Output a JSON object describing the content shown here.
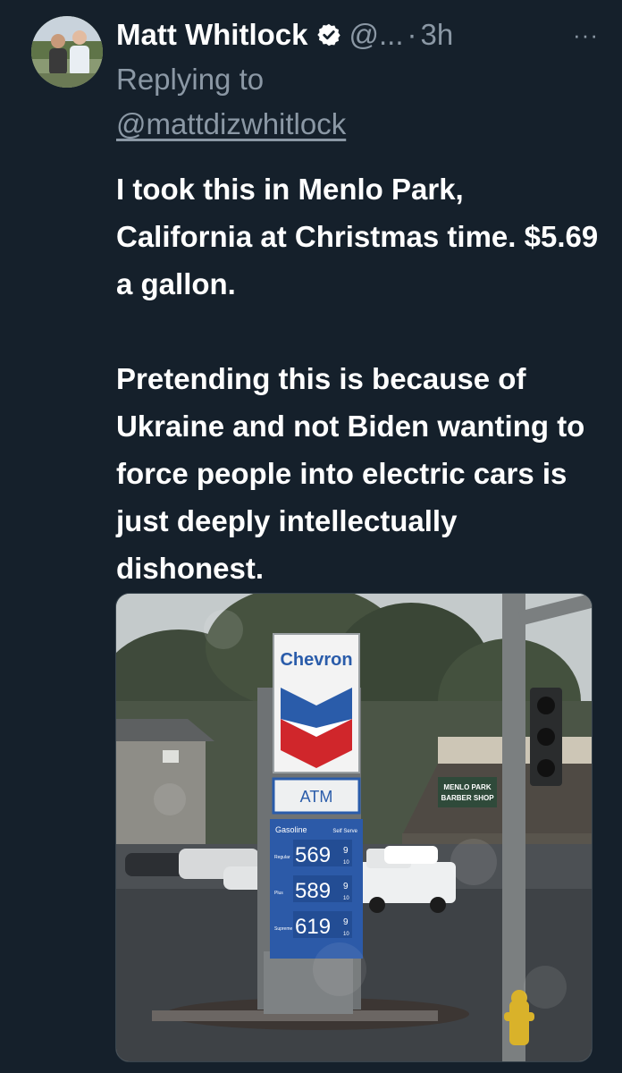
{
  "tweet": {
    "author_name": "Matt Whitlock",
    "handle": "@...",
    "separator": "·",
    "time": "3h",
    "more_label": "···",
    "replying_label": "Replying to",
    "reply_mention": "@mattdizwhitlock",
    "paragraphs": [
      "I took this in Menlo Park, California at Christmas time. $5.69 a gallon.",
      "Pretending this is because of Ukraine and not Biden wanting to force people into electric cars is just deeply intellectually dishonest."
    ]
  },
  "photo": {
    "brand": "Chevron",
    "atm": "ATM",
    "gasoline_label": "Gasoline",
    "self_serve_label": "Self Serve",
    "grades": [
      {
        "name": "Regular",
        "price": "569",
        "fraction": "9",
        "tenths": "10"
      },
      {
        "name": "Plus",
        "price": "589",
        "fraction": "9",
        "tenths": "10"
      },
      {
        "name": "Supreme",
        "price": "619",
        "fraction": "9",
        "tenths": "10"
      }
    ],
    "shop_sign_line1": "MENLO PARK",
    "shop_sign_line2": "BARBER SHOP"
  },
  "colors": {
    "background": "#15202b",
    "secondary_text": "#8b98a5",
    "verified_badge": "#ffffff",
    "chevron_blue": "#2a5caa",
    "chevron_red": "#d0262b",
    "price_panel": "#2c5aa8"
  },
  "icons": {
    "verified": "verified-badge-icon",
    "more": "more-options-icon"
  }
}
